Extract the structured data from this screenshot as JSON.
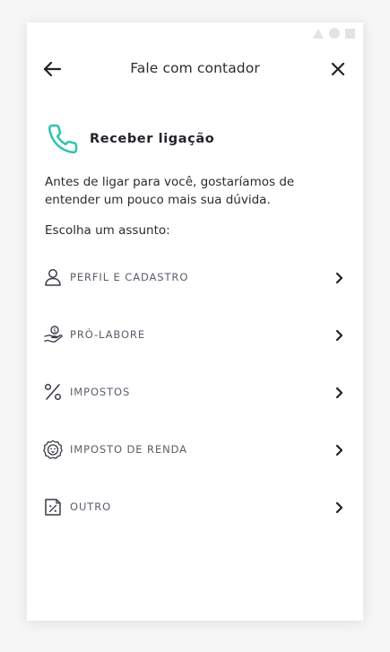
{
  "header": {
    "title": "Fale com contador",
    "back_icon": "arrow-left-icon",
    "close_icon": "close-icon"
  },
  "section": {
    "icon": "phone-icon",
    "title": "Receber ligação",
    "accent_color": "#2ec4b0"
  },
  "intro_text": "Antes de ligar para você, gostaríamos de entender um pouco mais sua dúvida.",
  "subject_prompt": "Escolha um assunto:",
  "subjects": [
    {
      "label": "PERFIL E CADASTRO",
      "icon": "user-icon"
    },
    {
      "label": "PRÓ-LABORE",
      "icon": "hand-coin-icon"
    },
    {
      "label": "IMPOSTOS",
      "icon": "percent-icon"
    },
    {
      "label": "IMPOSTO DE RENDA",
      "icon": "lion-icon"
    },
    {
      "label": "OUTRO",
      "icon": "document-percent-icon"
    }
  ]
}
